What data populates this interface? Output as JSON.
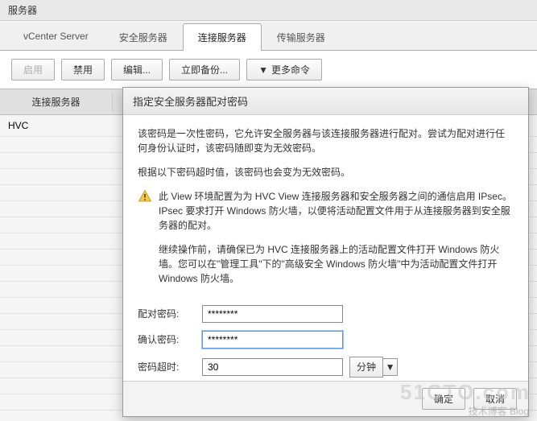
{
  "header": {
    "title": "服务器"
  },
  "tabs": [
    {
      "label": "vCenter Server"
    },
    {
      "label": "安全服务器"
    },
    {
      "label": "连接服务器",
      "active": true
    },
    {
      "label": "传输服务器"
    }
  ],
  "toolbar": {
    "enable": "启用",
    "disable": "禁用",
    "edit": "编辑...",
    "backup": "立即备份...",
    "more": "更多命令"
  },
  "columns": {
    "col1": "连接服务器"
  },
  "rows": [
    {
      "name": "HVC"
    }
  ],
  "dialog": {
    "title": "指定安全服务器配对密码",
    "para1": "该密码是一次性密码，它允许安全服务器与该连接服务器进行配对。尝试为配对进行任何身份认证时，该密码随即变为无效密码。",
    "para2": "根据以下密码超时值，该密码也会变为无效密码。",
    "warn1": "此 View 环境配置为为 HVC View 连接服务器和安全服务器之间的通信启用 IPsec。IPsec 要求打开 Windows 防火墙，以便将活动配置文件用于从连接服务器到安全服务器的配对。",
    "warn2": "继续操作前，请确保已为 HVC 连接服务器上的活动配置文件打开 Windows 防火墙。您可以在\"管理工具\"下的\"高级安全 Windows 防火墙\"中为活动配置文件打开 Windows 防火墙。",
    "form": {
      "password_label": "配对密码:",
      "password_value": "********",
      "confirm_label": "确认密码:",
      "confirm_value": "********",
      "timeout_label": "密码超时:",
      "timeout_value": "30",
      "timeout_unit": "分钟"
    },
    "buttons": {
      "ok": "确定",
      "cancel": "取消"
    }
  },
  "watermark": {
    "main": "51CTO.com",
    "sub": "技术博客   Blog"
  }
}
